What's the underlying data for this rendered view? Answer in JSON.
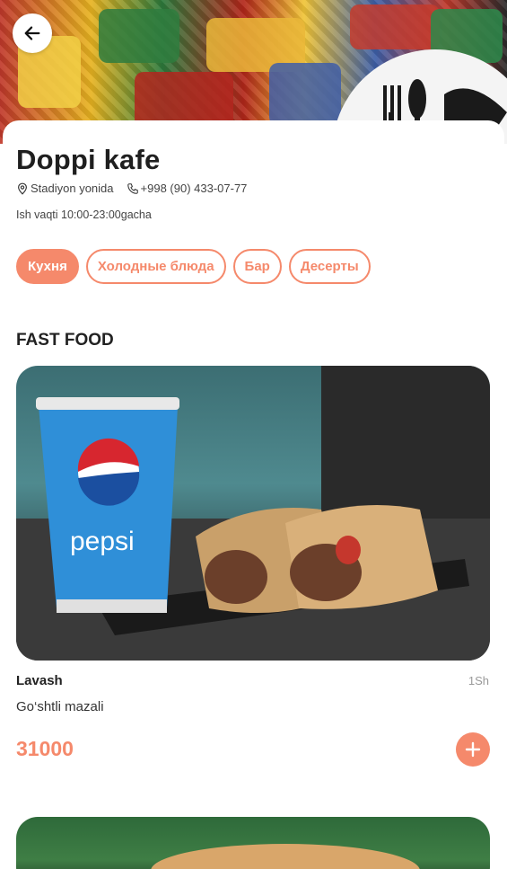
{
  "restaurant": {
    "name": "Doppi kafe",
    "location": "Stadiyon yonida",
    "phone": "+998 (90) 433-07-77",
    "hours": "Ish vaqti 10:00-23:00gacha"
  },
  "categories": [
    {
      "label": "Кухня",
      "active": true
    },
    {
      "label": "Холодные блюда",
      "active": false
    },
    {
      "label": "Бар",
      "active": false
    },
    {
      "label": "Десерты",
      "active": false
    }
  ],
  "section": {
    "title": "FAST FOOD"
  },
  "items": [
    {
      "name": "Lavash",
      "weight": "1Sh",
      "description": "Go‘shtli mazali",
      "price": "31000",
      "image_text": "pepsi"
    }
  ],
  "colors": {
    "accent": "#f5896b"
  },
  "icons": {
    "back": "arrow-left-icon",
    "location": "map-pin-icon",
    "phone": "phone-icon",
    "add": "plus-icon"
  }
}
